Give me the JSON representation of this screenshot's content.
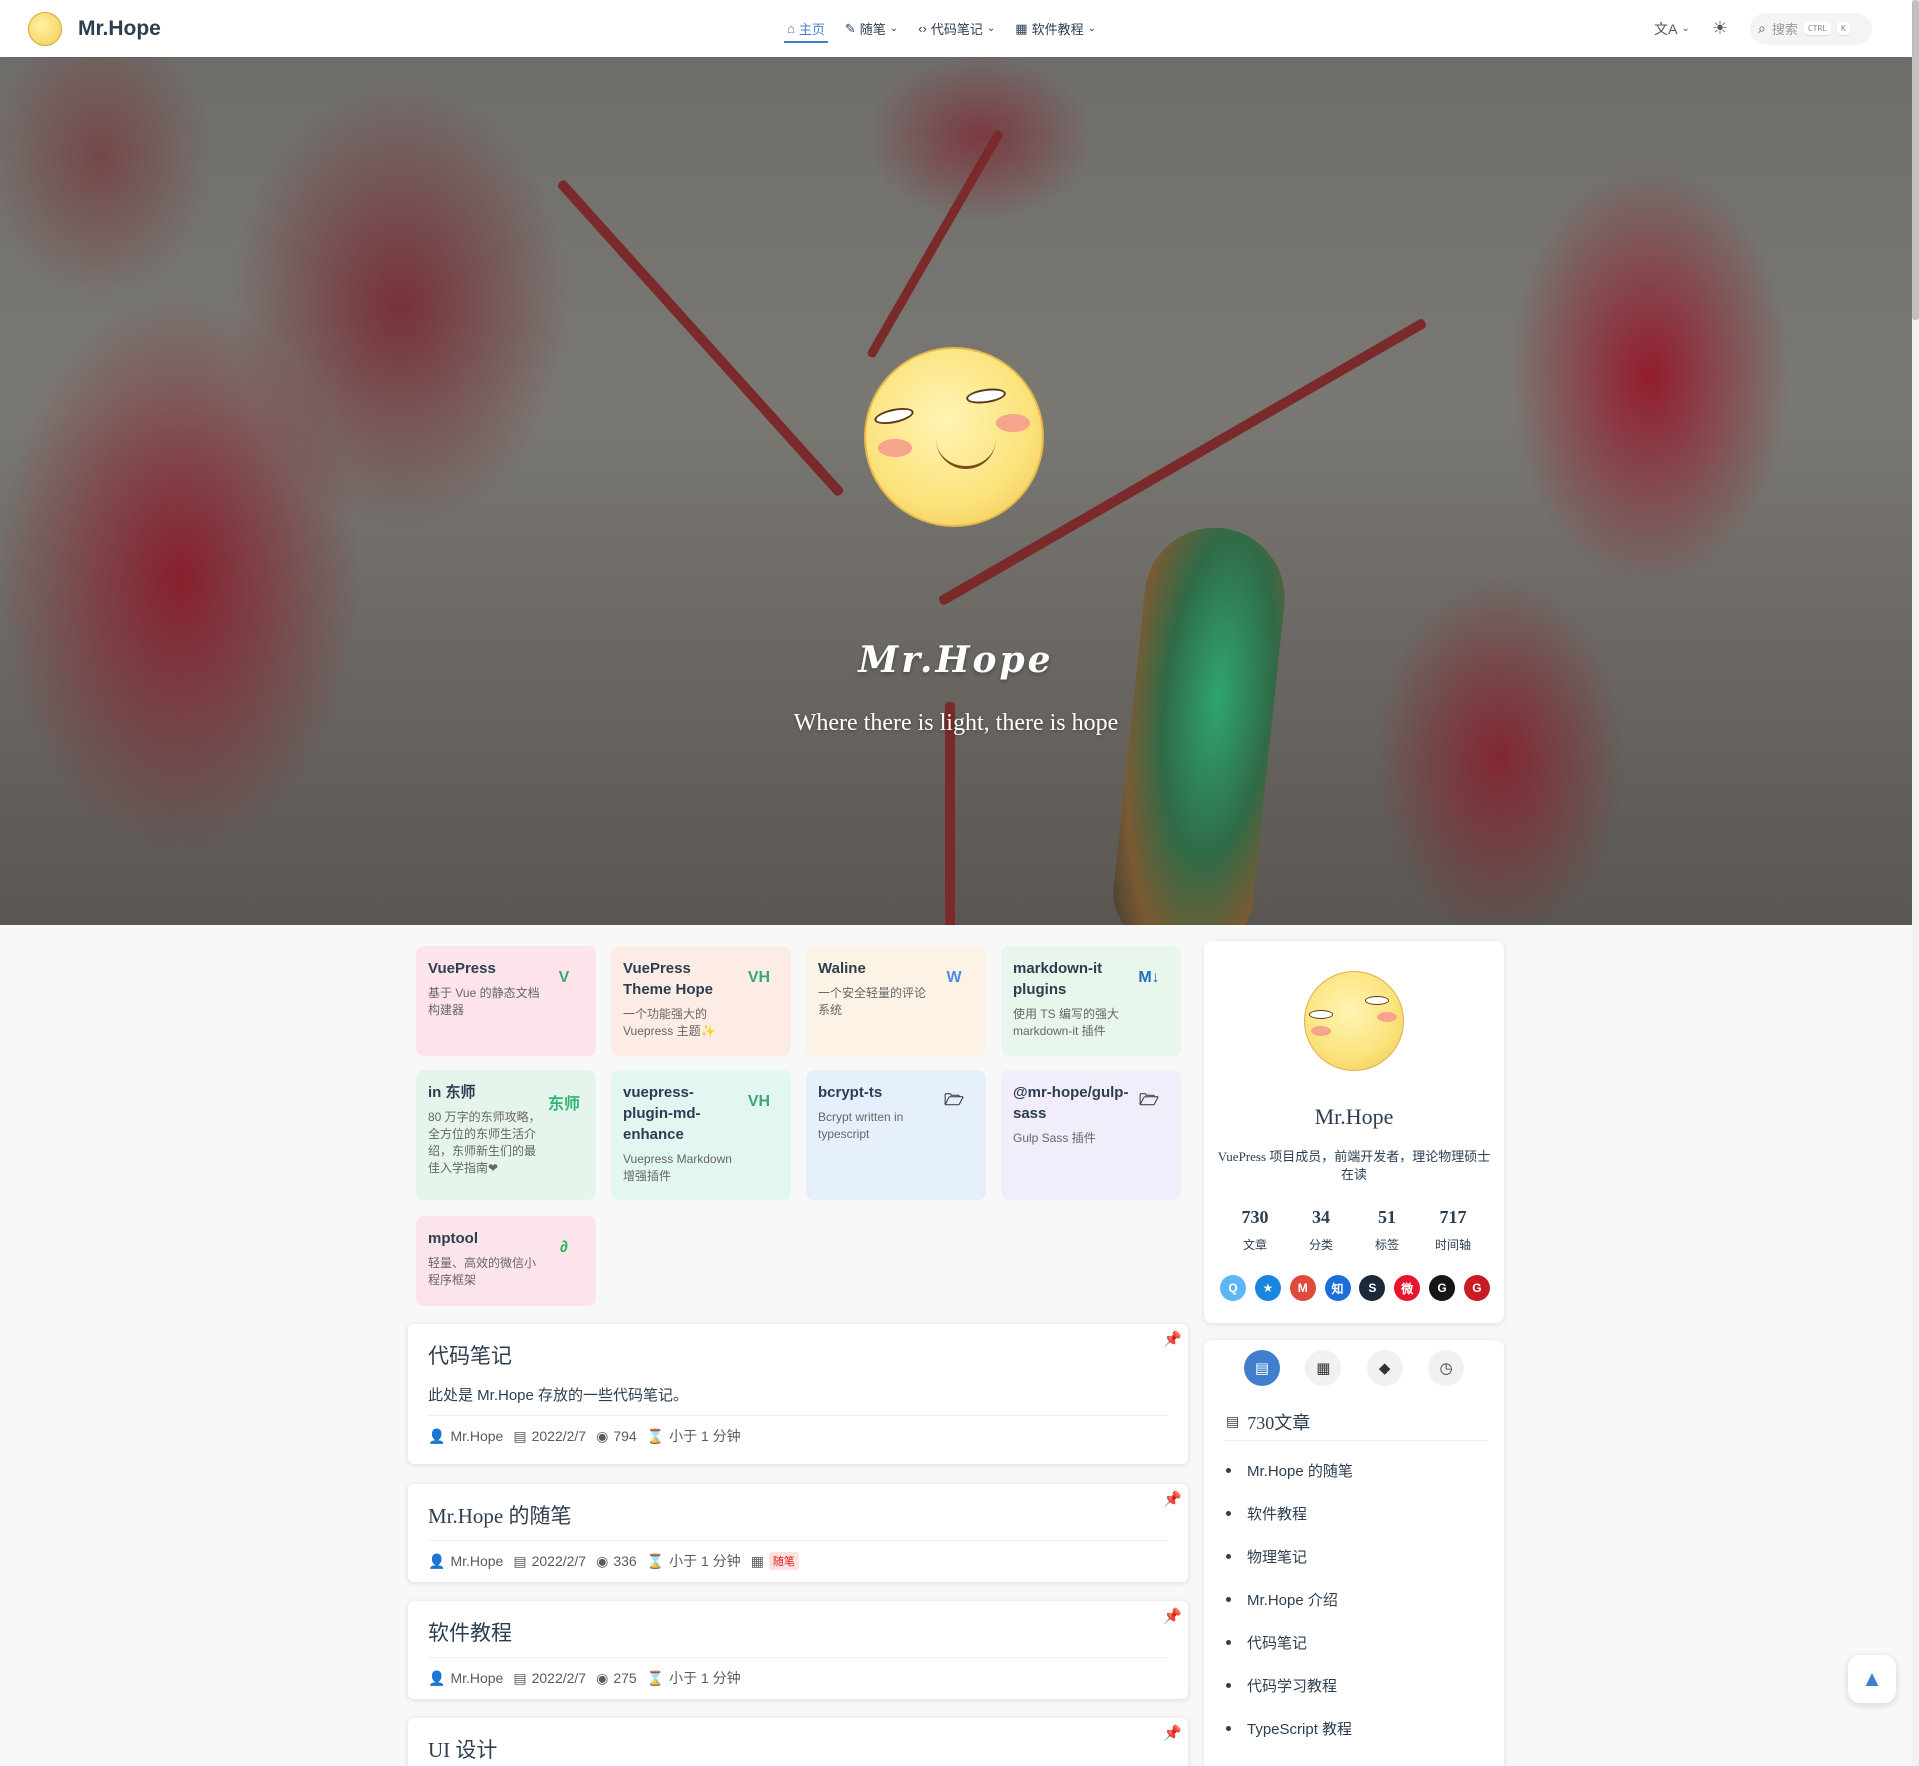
{
  "navbar": {
    "site_name": "Mr.Hope",
    "links": [
      {
        "icon": "⌂",
        "label": "主页",
        "active": true,
        "dropdown": false
      },
      {
        "icon": "✎",
        "label": "随笔",
        "active": false,
        "dropdown": true
      },
      {
        "icon": "‹›",
        "label": "代码笔记",
        "active": false,
        "dropdown": true
      },
      {
        "icon": "▦",
        "label": "软件教程",
        "active": false,
        "dropdown": true
      }
    ],
    "search_placeholder": "搜索",
    "search_kbd_1": "CTRL",
    "search_kbd_2": "K",
    "language_icon": "文A",
    "theme_icon": "☀"
  },
  "hero": {
    "title": "Mr.Hope",
    "subtitle": "Where there is light, there is hope",
    "arrow": "⌄"
  },
  "projects": [
    {
      "name": "VuePress",
      "desc": "基于 Vue 的静态文档构建器",
      "icon": "V",
      "bg": "#fce4ea",
      "icon_color": "#3aa776"
    },
    {
      "name": "VuePress Theme Hope",
      "desc": "一个功能强大的 Vuepress 主题✨",
      "icon": "VH",
      "bg": "#fdece6",
      "icon_color": "#3aa776"
    },
    {
      "name": "Waline",
      "desc": "一个安全轻量的评论系统",
      "icon": "W",
      "bg": "#fdf3e5",
      "icon_color": "#4a90e2"
    },
    {
      "name": "markdown-it plugins",
      "desc": "使用 TS 编写的强大 markdown-it 插件",
      "icon": "M↓",
      "bg": "#e9f6ec",
      "icon_color": "#1d6fc2"
    },
    {
      "name": "in 东师",
      "desc": "80 万字的东师攻略，全方位的东师生活介绍，东师新生们的最佳入学指南❤",
      "icon": "东师",
      "bg": "#e6f5ec",
      "icon_color": "#2bb673"
    },
    {
      "name": "vuepress-plugin-md-enhance",
      "desc": "Vuepress Markdown 增强插件",
      "icon": "VH",
      "bg": "#e2f6f2",
      "icon_color": "#3aa776"
    },
    {
      "name": "bcrypt-ts",
      "desc": "Bcrypt written in typescript",
      "icon": "🗁",
      "bg": "#e6f0fc",
      "icon_color": "#333"
    },
    {
      "name": "@mr-hope/gulp-sass",
      "desc": "Gulp Sass 插件",
      "icon": "🗁",
      "bg": "#f1edfb",
      "icon_color": "#333"
    },
    {
      "name": "mptool",
      "desc": "轻量、高效的微信小程序框架",
      "icon": "∂",
      "bg": "#fce4ec",
      "icon_color": "#1fb35a"
    }
  ],
  "articles": [
    {
      "title": "代码笔记",
      "excerpt": "此处是 Mr.Hope 存放的一些代码笔记。",
      "author": "Mr.Hope",
      "date": "2022/2/7",
      "views": "794",
      "read_time": "小于 1 分钟",
      "tag": ""
    },
    {
      "title": "Mr.Hope 的随笔",
      "excerpt": "",
      "author": "Mr.Hope",
      "date": "2022/2/7",
      "views": "336",
      "read_time": "小于 1 分钟",
      "tag": "随笔"
    },
    {
      "title": "软件教程",
      "excerpt": "",
      "author": "Mr.Hope",
      "date": "2022/2/7",
      "views": "275",
      "read_time": "小于 1 分钟",
      "tag": ""
    },
    {
      "title": "UI 设计",
      "excerpt": "",
      "author": "",
      "date": "",
      "views": "",
      "read_time": "",
      "tag": ""
    }
  ],
  "profile": {
    "name": "Mr.Hope",
    "description": "VuePress 项目成员，前端开发者，理论物理硕士在读",
    "stats": [
      {
        "num": "730",
        "label": "文章"
      },
      {
        "num": "34",
        "label": "分类"
      },
      {
        "num": "51",
        "label": "标签"
      },
      {
        "num": "717",
        "label": "时间轴"
      }
    ],
    "socials": [
      {
        "name": "qq-icon",
        "glyph": "Q",
        "color": "#5cb6f7"
      },
      {
        "name": "qzone-icon",
        "glyph": "★",
        "color": "#1a86e0"
      },
      {
        "name": "gmail-icon",
        "glyph": "M",
        "color": "#e04a3b"
      },
      {
        "name": "zhihu-icon",
        "glyph": "知",
        "color": "#1a6fd6"
      },
      {
        "name": "steam-icon",
        "glyph": "S",
        "color": "#1b2838"
      },
      {
        "name": "weibo-icon",
        "glyph": "微",
        "color": "#e6162d"
      },
      {
        "name": "github-icon",
        "glyph": "G",
        "color": "#171515"
      },
      {
        "name": "gitee-icon",
        "glyph": "G",
        "color": "#c71d23"
      }
    ]
  },
  "category_card": {
    "count_label": "730文章",
    "items": [
      "Mr.Hope 的随笔",
      "软件教程",
      "物理笔记",
      "Mr.Hope 介绍",
      "代码笔记",
      "代码学习教程",
      "TypeScript 教程"
    ]
  }
}
